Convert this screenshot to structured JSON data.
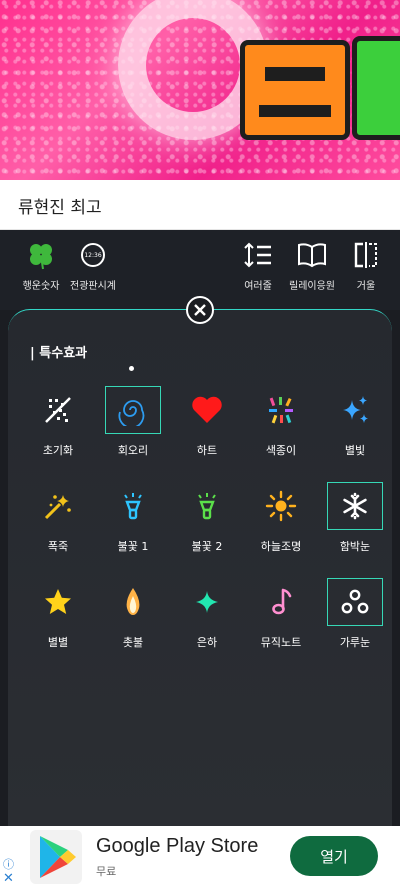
{
  "video": {
    "title": "류현진 최고"
  },
  "toolbar": {
    "items": [
      {
        "label": "행운숫자",
        "icon": "clover-icon"
      },
      {
        "label": "전광판시계",
        "icon": "clock-icon",
        "clock_text": "12:36"
      },
      {
        "label": "여러줄",
        "icon": "line-spacing-icon"
      },
      {
        "label": "릴레이응원",
        "icon": "book-icon"
      },
      {
        "label": "거울",
        "icon": "mirror-icon"
      }
    ]
  },
  "panel": {
    "heading": "| 특수효과",
    "accent_color": "#36d8b6",
    "effects": [
      {
        "label": "초기화",
        "icon": "reset-sparkle-icon",
        "selected": false
      },
      {
        "label": "회오리",
        "icon": "whirlwind-icon",
        "selected": true
      },
      {
        "label": "하트",
        "icon": "heart-icon",
        "selected": false
      },
      {
        "label": "색종이",
        "icon": "confetti-icon",
        "selected": false
      },
      {
        "label": "별빛",
        "icon": "sparkle-stars-icon",
        "selected": false
      },
      {
        "label": "폭죽",
        "icon": "firecracker-icon",
        "selected": false
      },
      {
        "label": "불꽃 1",
        "icon": "torch-blue-icon",
        "selected": false
      },
      {
        "label": "불꽃 2",
        "icon": "torch-green-icon",
        "selected": false
      },
      {
        "label": "하늘조명",
        "icon": "sun-light-icon",
        "selected": false
      },
      {
        "label": "함박눈",
        "icon": "snowflake-icon",
        "selected": true
      },
      {
        "label": "별별",
        "icon": "star-icon",
        "selected": false
      },
      {
        "label": "촛불",
        "icon": "candle-flame-icon",
        "selected": false
      },
      {
        "label": "은하",
        "icon": "galaxy-sparkle-icon",
        "selected": false
      },
      {
        "label": "뮤직노트",
        "icon": "music-note-icon",
        "selected": false
      },
      {
        "label": "가루눈",
        "icon": "powder-snow-icon",
        "selected": true
      }
    ]
  },
  "ad": {
    "title": "Google Play Store",
    "subtitle": "무료",
    "button": "열기"
  }
}
